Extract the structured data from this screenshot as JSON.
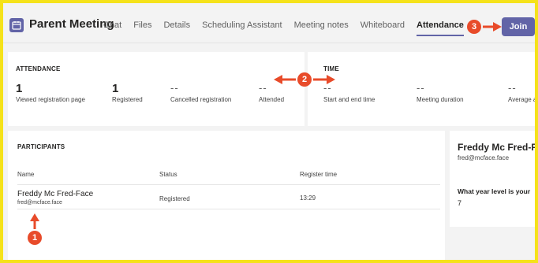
{
  "header": {
    "title": "Parent Meeting",
    "tabs": [
      {
        "label": "Chat"
      },
      {
        "label": "Files"
      },
      {
        "label": "Details"
      },
      {
        "label": "Scheduling Assistant"
      },
      {
        "label": "Meeting notes"
      },
      {
        "label": "Whiteboard"
      },
      {
        "label": "Attendance",
        "active": true
      }
    ],
    "join_label": "Join"
  },
  "attendance": {
    "title": "ATTENDANCE",
    "stats": [
      {
        "value": "1",
        "label": "Viewed registration page"
      },
      {
        "value": "1",
        "label": "Registered"
      },
      {
        "value": "--",
        "label": "Cancelled registration"
      },
      {
        "value": "--",
        "label": "Attended"
      }
    ]
  },
  "time": {
    "title": "TIME",
    "stats": [
      {
        "value": "--",
        "label": "Start and end time"
      },
      {
        "value": "--",
        "label": "Meeting duration"
      },
      {
        "value": "--",
        "label": "Average a"
      }
    ]
  },
  "participants": {
    "title": "PARTICIPANTS",
    "columns": [
      "Name",
      "Status",
      "Register time"
    ],
    "rows": [
      {
        "name": "Freddy Mc Fred-Face",
        "email": "fred@mcface.face",
        "status": "Registered",
        "time": "13:29"
      }
    ]
  },
  "details": {
    "name": "Freddy Mc Fred-Fa",
    "email": "fred@mcface.face",
    "question": "What year level is your",
    "answer": "7"
  },
  "annotations": [
    "1",
    "2",
    "3"
  ],
  "colors": {
    "accent": "#6264a7",
    "annotation": "#e84b2a",
    "frame": "#f5e21a"
  }
}
